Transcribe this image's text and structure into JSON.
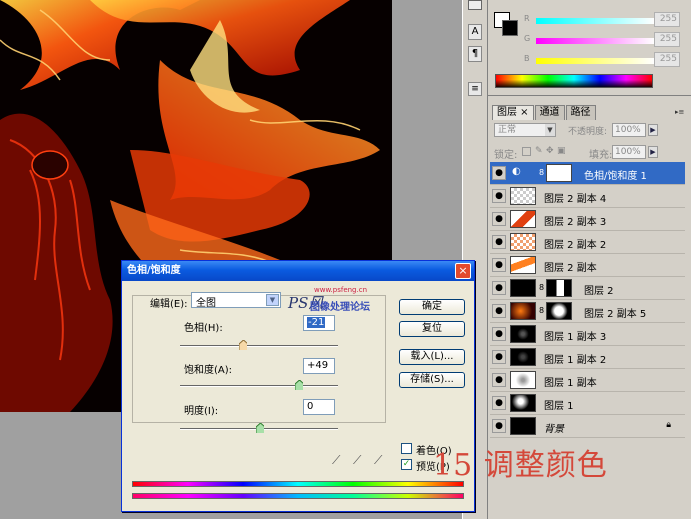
{
  "color_panel": {
    "r_label": "R",
    "r_value": "255",
    "g_label": "G",
    "g_value": "255",
    "b_label": "B",
    "b_value": "255"
  },
  "layers_panel": {
    "tabs": [
      "图层 ×",
      "通道",
      "路径"
    ],
    "blend_mode": "正常",
    "opacity_label": "不透明度:",
    "opacity_value": "100%",
    "lock_label": "锁定:",
    "fill_label": "填充:",
    "fill_value": "100%",
    "layers": [
      {
        "name": "色相/饱和度 1",
        "selected": true
      },
      {
        "name": "图层 2 副本 4"
      },
      {
        "name": "图层 2 副本 3"
      },
      {
        "name": "图层 2 副本 2"
      },
      {
        "name": "图层 2 副本"
      },
      {
        "name": "图层 2"
      },
      {
        "name": "图层 2 副本 5"
      },
      {
        "name": "图层 1 副本 3"
      },
      {
        "name": "图层 1 副本 2"
      },
      {
        "name": "图层 1 副本"
      },
      {
        "name": "图层 1"
      },
      {
        "name": "背景"
      }
    ]
  },
  "dialog": {
    "title": "色相/饱和度",
    "close": "×",
    "edit_label": "编辑(E):",
    "edit_value": "全图",
    "hue_label": "色相(H):",
    "hue_value": "-21",
    "saturation_label": "饱和度(A):",
    "saturation_value": "+49",
    "lightness_label": "明度(I):",
    "lightness_value": "0",
    "ok": "确定",
    "reset": "复位",
    "load": "载入(L)...",
    "save": "存储(S)...",
    "colorize_label": "着色(O)",
    "colorize": false,
    "preview_label": "预览(P)",
    "preview": true
  },
  "watermark": {
    "site": "www.psfeng.cn",
    "logo_text": "PS风",
    "forum": "图像处理论坛"
  },
  "caption": "15 调整颜色"
}
